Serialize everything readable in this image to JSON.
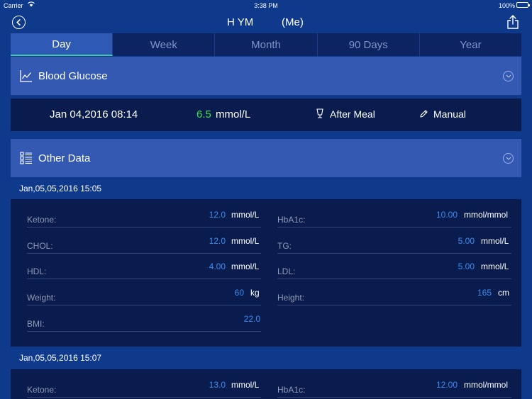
{
  "status": {
    "carrier": "Carrier",
    "time": "3:38 PM",
    "battery": "100%"
  },
  "nav": {
    "title": "H YM",
    "subtitle": "(Me)"
  },
  "tabs": [
    {
      "label": "Day",
      "active": true
    },
    {
      "label": "Week",
      "active": false
    },
    {
      "label": "Month",
      "active": false
    },
    {
      "label": "90 Days",
      "active": false
    },
    {
      "label": "Year",
      "active": false
    }
  ],
  "blood_glucose": {
    "title": "Blood Glucose",
    "date": "Jan 04,2016 08:14",
    "value": "6.5",
    "unit": "mmol/L",
    "meal": "After Meal",
    "source": "Manual"
  },
  "other_data": {
    "title": "Other Data",
    "records": [
      {
        "date": "Jan,05,05,2016 15:05",
        "left": [
          {
            "label": "Ketone:",
            "value": "12.0",
            "unit": "mmol/L"
          },
          {
            "label": "CHOL:",
            "value": "12.0",
            "unit": "mmol/L"
          },
          {
            "label": "HDL:",
            "value": "4.00",
            "unit": "mmol/L"
          },
          {
            "label": "Weight:",
            "value": "60",
            "unit": "kg"
          },
          {
            "label": "BMI:",
            "value": "22.0",
            "unit": ""
          }
        ],
        "right": [
          {
            "label": "HbA1c:",
            "value": "10.00",
            "unit": "mmol/mmol"
          },
          {
            "label": "TG:",
            "value": "5.00",
            "unit": "mmol/L"
          },
          {
            "label": "LDL:",
            "value": "5.00",
            "unit": "mmol/L"
          },
          {
            "label": "Height:",
            "value": "165",
            "unit": "cm"
          }
        ]
      },
      {
        "date": "Jan,05,05,2016 15:07",
        "left": [
          {
            "label": "Ketone:",
            "value": "13.0",
            "unit": "mmol/L"
          }
        ],
        "right": [
          {
            "label": "HbA1c:",
            "value": "12.00",
            "unit": "mmol/mmol"
          }
        ]
      }
    ]
  },
  "colors": {
    "background": "#0f3a8c",
    "section_header": "#3359b3",
    "card": "#0a1c4e",
    "glucose_value": "#3fe24c",
    "data_value": "#3b8cf0",
    "tab_indicator": "#3ec7a6"
  }
}
